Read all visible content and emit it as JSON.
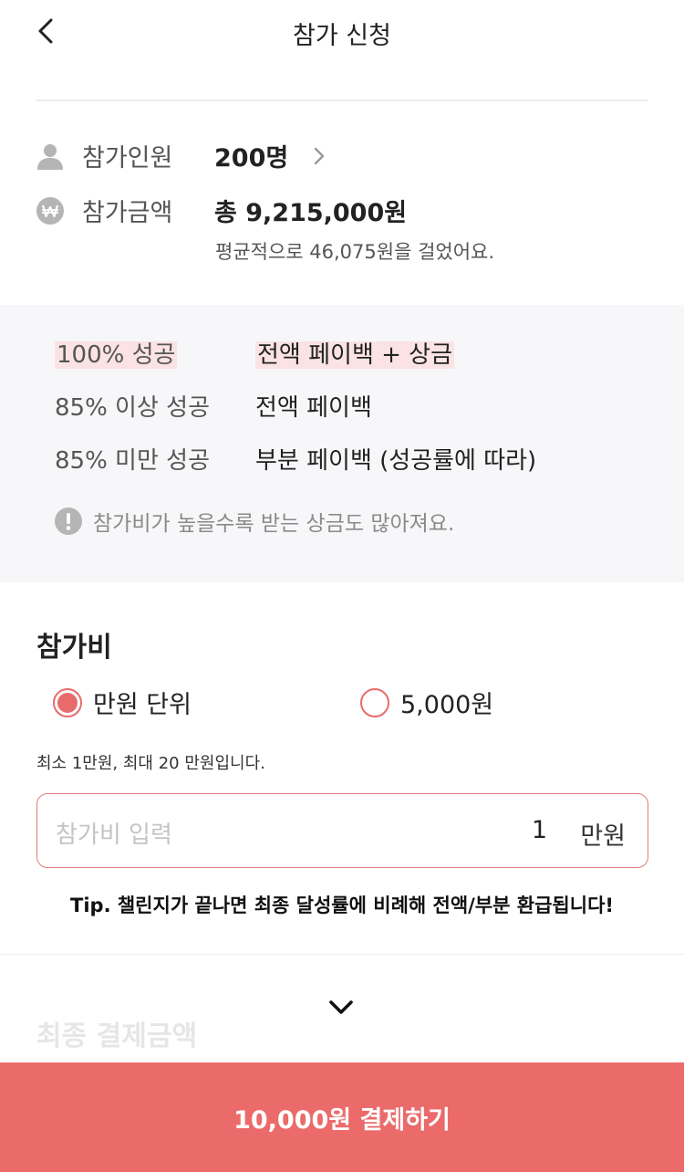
{
  "header": {
    "title": "참가 신청"
  },
  "summary": {
    "participants": {
      "label": "참가인원",
      "value": "200명"
    },
    "amount": {
      "label": "참가금액",
      "value": "총 9,215,000원",
      "sub": "평균적으로 46,075원을 걸었어요."
    }
  },
  "rewards": [
    {
      "condition": "100% 성공",
      "result": "전액 페이백 + 상금"
    },
    {
      "condition": "85% 이상 성공",
      "result": "전액 페이백"
    },
    {
      "condition": "85% 미만 성공",
      "result": "부분 페이백 (성공률에 따라)"
    }
  ],
  "notice": "참가비가 높을수록 받는 상금도 많아져요.",
  "fee": {
    "title": "참가비",
    "options": [
      {
        "label": "만원 단위",
        "selected": true
      },
      {
        "label": "5,000원",
        "selected": false
      }
    ],
    "helper": "최소 1만원, 최대 20 만원입니다.",
    "placeholder": "참가비 입력",
    "value": "1",
    "unit": "만원"
  },
  "tip": "Tip. 챌린지가 끝나면 최종 달성률에 비례해 전액/부분 환급됩니다!",
  "final": {
    "title": "최종 결제금액"
  },
  "pay_button": {
    "label": "10,000원 결제하기"
  },
  "colors": {
    "accent": "#eb6b6b",
    "highlight": "#fbe3e3",
    "panel": "#f7f7f9"
  }
}
